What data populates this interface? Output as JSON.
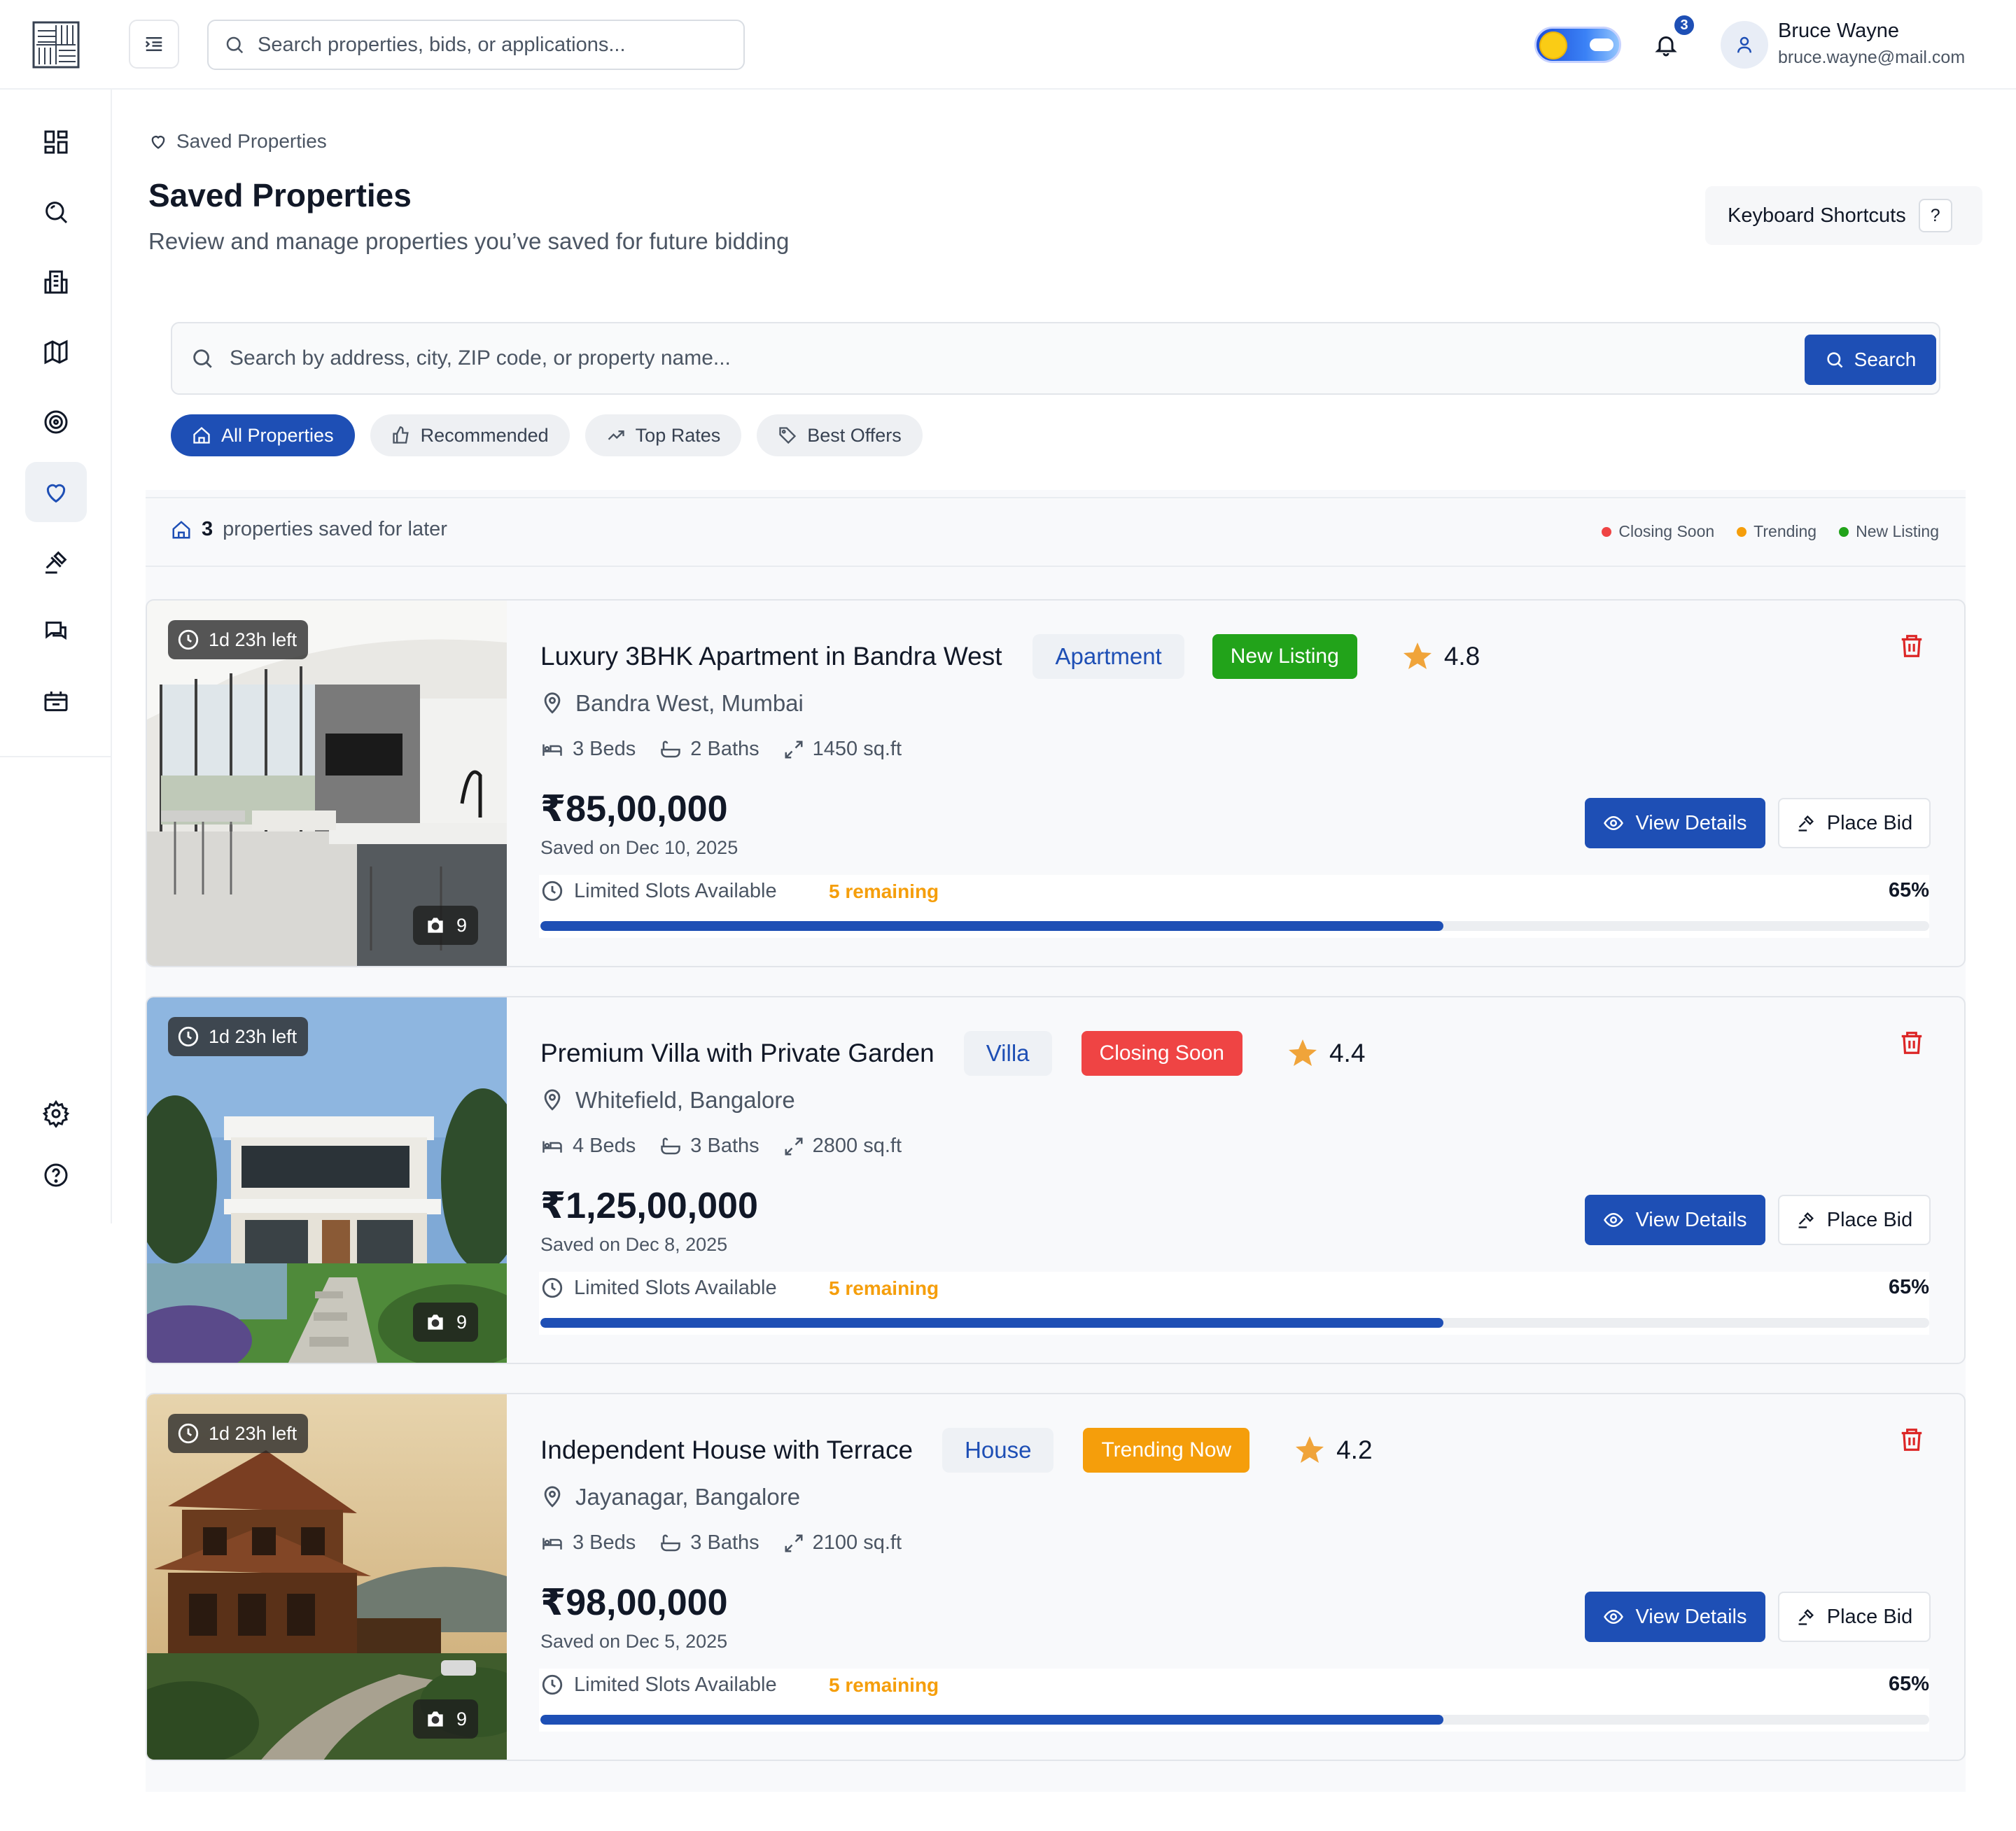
{
  "colors": {
    "brand": "#1e4fb5",
    "closing": "#ef4444",
    "trending": "#f59e0b",
    "new_listing": "#22a31a",
    "star": "#f0a43a",
    "delete": "#dc2626"
  },
  "header": {
    "search_placeholder": "Search properties, bids, or applications...",
    "notifications_count": "3",
    "user_name": "Bruce Wayne",
    "user_email": "bruce.wayne@mail.com"
  },
  "sidebar": {
    "items": [
      "dashboard-icon",
      "search-icon",
      "building-icon",
      "map-icon",
      "target-icon",
      "heart-icon",
      "gavel-icon",
      "chat-icon",
      "ticket-icon"
    ],
    "bottom": [
      "settings-icon",
      "help-icon"
    ],
    "active": "heart-icon"
  },
  "page": {
    "breadcrumb": "Saved Properties",
    "title": "Saved Properties",
    "subtitle": "Review and manage properties you’ve saved for future bidding",
    "keyboard_shortcuts": "Keyboard Shortcuts",
    "keyboard_key": "?"
  },
  "search": {
    "placeholder": "Search by address, city, ZIP code, or property name...",
    "button": "Search"
  },
  "filters": [
    "All Properties",
    "Recommended",
    "Top Rates",
    "Best Offers"
  ],
  "summary": {
    "count": "3",
    "text": "properties saved for later",
    "legend": [
      "Closing Soon",
      "Trending",
      "New Listing"
    ]
  },
  "properties": [
    {
      "timer": "1d 23h left",
      "photos": "9",
      "title": "Luxury 3BHK Apartment in Bandra West",
      "type": "Apartment",
      "status": "New Listing",
      "status_color": "#22a31a",
      "rating": "4.8",
      "location": "Bandra West, Mumbai",
      "beds": "3 Beds",
      "baths": "2 Baths",
      "area": "1450 sq.ft",
      "price": "₹85,00,000",
      "saved_on": "Saved on Dec 10, 2025",
      "view_label": "View Details",
      "bid_label": "Place Bid",
      "slots_label": "Limited Slots Available",
      "remaining": "5 remaining",
      "percent_label": "65%",
      "progress": 0.65
    },
    {
      "timer": "1d 23h left",
      "photos": "9",
      "title": "Premium Villa with Private Garden",
      "type": "Villa",
      "status": "Closing Soon",
      "status_color": "#ef4444",
      "rating": "4.4",
      "location": "Whitefield, Bangalore",
      "beds": "4 Beds",
      "baths": "3 Baths",
      "area": "2800 sq.ft",
      "price": "₹1,25,00,000",
      "saved_on": "Saved on Dec 8, 2025",
      "view_label": "View Details",
      "bid_label": "Place Bid",
      "slots_label": "Limited Slots Available",
      "remaining": "5 remaining",
      "percent_label": "65%",
      "progress": 0.65
    },
    {
      "timer": "1d 23h left",
      "photos": "9",
      "title": "Independent House with Terrace",
      "type": "House",
      "status": "Trending Now",
      "status_color": "#f59e0b",
      "rating": "4.2",
      "location": "Jayanagar, Bangalore",
      "beds": "3 Beds",
      "baths": "3 Baths",
      "area": "2100 sq.ft",
      "price": "₹98,00,000",
      "saved_on": "Saved on Dec 5, 2025",
      "view_label": "View Details",
      "bid_label": "Place Bid",
      "slots_label": "Limited Slots Available",
      "remaining": "5 remaining",
      "percent_label": "65%",
      "progress": 0.65
    }
  ]
}
